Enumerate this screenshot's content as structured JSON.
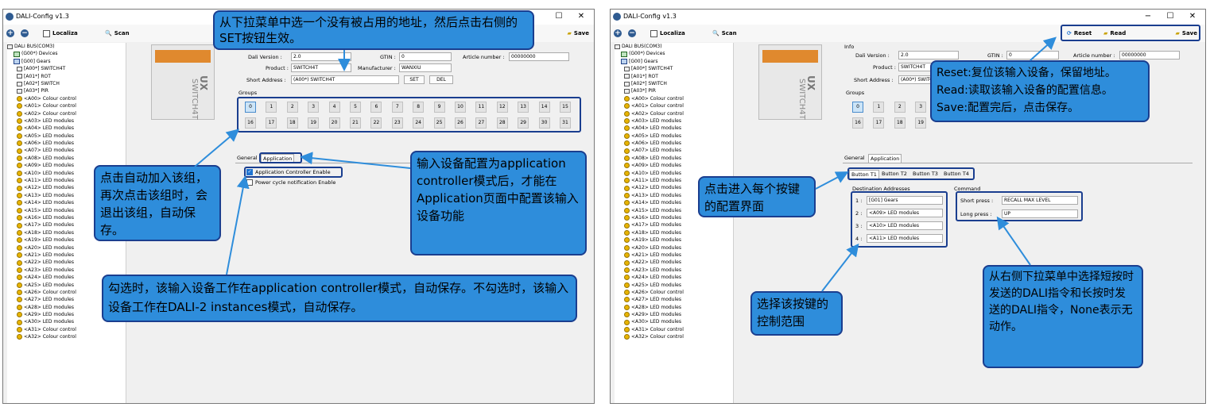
{
  "window_title": "DALI-Config v1.3",
  "toolbar": {
    "localize": "Localiza",
    "scan": "Scan",
    "reset": "Reset",
    "read": "Read",
    "save": "Save"
  },
  "tree": [
    "DALI BUS(COM3)",
    "(G00*) Devices",
    "[G00] Gears",
    "[A00*] SWITCH4T",
    "[A01*] ROT",
    "[A02*] SWITCH",
    "[A03*] PIR",
    "<A00> Colour control",
    "<A01> Colour control",
    "<A02> Colour control",
    "<A03> LED modules",
    "<A04> LED modules",
    "<A05> LED modules",
    "<A06> LED modules",
    "<A07> LED modules",
    "<A08> LED modules",
    "<A09> LED modules",
    "<A10> LED modules",
    "<A11> LED modules",
    "<A12> LED modules",
    "<A13> LED modules",
    "<A14> LED modules",
    "<A15> LED modules",
    "<A16> LED modules",
    "<A17> LED modules",
    "<A18> LED modules",
    "<A19> LED modules",
    "<A20> LED modules",
    "<A21> LED modules",
    "<A22> LED modules",
    "<A23> LED modules",
    "<A24> LED modules",
    "<A25> LED modules",
    "<A26> Colour control",
    "<A27> LED modules",
    "<A28> LED modules",
    "<A29> LED modules",
    "<A30> LED modules",
    "<A31> Colour control",
    "<A32> Colour control"
  ],
  "device": {
    "brand": "UX",
    "model": "SWITCH4T"
  },
  "info": {
    "title": "Info",
    "dali_version_label": "Dali Version :",
    "dali_version": "2.0",
    "gtin_label": "GTIN :",
    "gtin": "0",
    "article_label": "Article number :",
    "article": "00000000",
    "product_label": "Product :",
    "product": "SWITCH4T",
    "manufacturer_label": "Manufacturer :",
    "manufacturer": "WANXIU",
    "short_address_label": "Short Address :",
    "short_address": "(A00*) SWITCH4T",
    "set": "SET",
    "del": "DEL"
  },
  "groups_title": "Groups",
  "groups": [
    "0",
    "1",
    "2",
    "3",
    "4",
    "5",
    "6",
    "7",
    "8",
    "9",
    "10",
    "11",
    "12",
    "13",
    "14",
    "15",
    "16",
    "17",
    "18",
    "19",
    "20",
    "21",
    "22",
    "23",
    "24",
    "25",
    "26",
    "27",
    "28",
    "29",
    "30",
    "31"
  ],
  "tabs": {
    "general": "General",
    "application": "Application"
  },
  "app_options": {
    "controller_enable": "Application Controller Enable",
    "power_cycle": "Power cycle notification Enable"
  },
  "button_tabs": [
    "Button T1",
    "Button T2",
    "Button T3",
    "Button T4"
  ],
  "destination": {
    "title": "Destination Addresses",
    "rows": [
      {
        "num": "1 :",
        "value": "[G01] Gears"
      },
      {
        "num": "2 :",
        "value": "<A09> LED modules"
      },
      {
        "num": "3 :",
        "value": "<A10> LED modules"
      },
      {
        "num": "4 :",
        "value": "<A11> LED modules"
      }
    ]
  },
  "command": {
    "title": "Command",
    "short_label": "Short press :",
    "short_value": "RECALL MAX LEVEL",
    "long_label": "Long press :",
    "long_value": "UP"
  },
  "callouts": {
    "select_address": "从下拉菜单中选一个没有被占用的地址，然后点击右侧的SET按钮生效。",
    "groups": "点击自动加入该组，再次点击该组时，会退出该组，自动保存。",
    "app_mode": "输入设备配置为application controller模式后，才能在Application页面中配置该输入设备功能",
    "checkbox": "勾选时，该输入设备工作在application controller模式，自动保存。不勾选时，该输入设备工作在DALI-2 instances模式，自动保存。",
    "reset_read_save": "Reset:复位该输入设备，保留地址。Read:读取该输入设备的配置信息。Save:配置完后，点击保存。",
    "button_tabs": "点击进入每个按键的配置界面",
    "dest_range": "选择该按键的控制范围",
    "command_help": "从右侧下拉菜单中选择短按时发送的DALI指令和长按时发送的DALI指令，None表示无动作。"
  }
}
